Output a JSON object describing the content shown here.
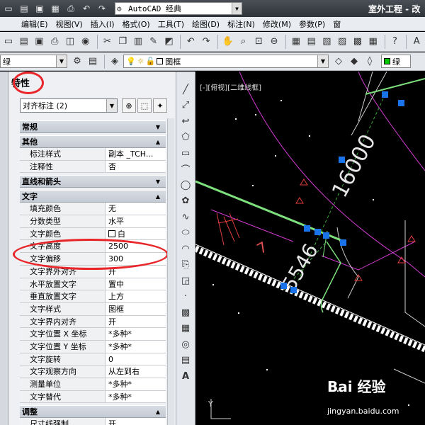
{
  "titlebar": {
    "workspace": "AutoCAD 经典",
    "app_title": "室外工程 - 改"
  },
  "menu": [
    "编辑(E)",
    "视图(V)",
    "插入(I)",
    "格式(O)",
    "工具(T)",
    "绘图(D)",
    "标注(N)",
    "修改(M)",
    "参数(P)",
    "窗"
  ],
  "layer_combo": "绿",
  "layer_name": "图框",
  "color_combo": "绿",
  "properties": {
    "title": "特性",
    "selected_object": "对齐标注 (2)",
    "categories": {
      "general": "常规",
      "misc": "其他",
      "lines_arrows": "直线和箭头",
      "text": "文字",
      "adjust": "调整"
    },
    "misc_rows": [
      {
        "key": "标注样式",
        "value": "副本 _TCH..."
      },
      {
        "key": "注释性",
        "value": "否"
      }
    ],
    "text_rows": [
      {
        "key": "填充颜色",
        "value": "无"
      },
      {
        "key": "分数类型",
        "value": "水平"
      },
      {
        "key": "文字颜色",
        "value": "白"
      },
      {
        "key": "文字高度",
        "value": "2500"
      },
      {
        "key": "文字偏移",
        "value": "300"
      },
      {
        "key": "文字界外对齐",
        "value": "开"
      },
      {
        "key": "水平放置文字",
        "value": "置中"
      },
      {
        "key": "垂直放置文字",
        "value": "上方"
      },
      {
        "key": "文字样式",
        "value": "图框"
      },
      {
        "key": "文字界内对齐",
        "value": "开"
      },
      {
        "key": "文字位置 X 坐标",
        "value": "*多种*"
      },
      {
        "key": "文字位置 Y 坐标",
        "value": "*多种*"
      },
      {
        "key": "文字旋转",
        "value": "0"
      },
      {
        "key": "文字观察方向",
        "value": "从左到右"
      },
      {
        "key": "测量单位",
        "value": "*多种*"
      },
      {
        "key": "文字替代",
        "value": "*多种*"
      }
    ],
    "adjust_rows": [
      {
        "key": "尺寸线强制",
        "value": "开"
      }
    ]
  },
  "canvas": {
    "viewport_label": "[-][俯视][二维线框]",
    "dim_text_1": "16000",
    "dim_text_2": "5546",
    "drawing_text": "7",
    "axis_label": "Y"
  },
  "watermark": {
    "brand": "Bai 经验",
    "url": "jingyan.baidu.com"
  }
}
